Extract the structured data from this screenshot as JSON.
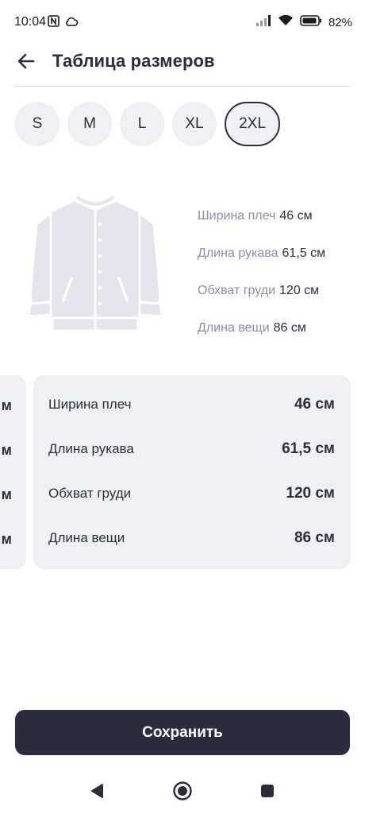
{
  "status_bar": {
    "time": "10:04",
    "battery": "82%",
    "icons": [
      "nfc-icon",
      "cloud-icon",
      "signal-icon",
      "wifi-icon",
      "battery-icon"
    ]
  },
  "header": {
    "title": "Таблица размеров",
    "back_icon": "arrow-left-icon"
  },
  "sizes": [
    {
      "label": "S",
      "selected": false
    },
    {
      "label": "M",
      "selected": false
    },
    {
      "label": "L",
      "selected": false
    },
    {
      "label": "XL",
      "selected": false
    },
    {
      "label": "2XL",
      "selected": true
    }
  ],
  "illustration": {
    "icon": "jacket-icon"
  },
  "measurements": [
    {
      "label": "Ширина плеч",
      "value": "46 см"
    },
    {
      "label": "Длина рукава",
      "value": "61,5 см"
    },
    {
      "label": "Обхват груди",
      "value": "120 см"
    },
    {
      "label": "Длина вещи",
      "value": "86 см"
    }
  ],
  "prev_card": {
    "values": [
      "м",
      "м",
      "м",
      "м"
    ]
  },
  "card": {
    "rows": [
      {
        "label": "Ширина плеч",
        "value": "46 см"
      },
      {
        "label": "Длина рукава",
        "value": "61,5 см"
      },
      {
        "label": "Обхват груди",
        "value": "120 см"
      },
      {
        "label": "Длина вещи",
        "value": "86 см"
      }
    ]
  },
  "save_label": "Сохранить",
  "nav": [
    "back-triangle-icon",
    "home-circle-icon",
    "recents-square-icon"
  ],
  "colors": {
    "primary": "#2b2d3f",
    "chip_bg": "#eff0f4",
    "muted_text": "#8b8da0"
  }
}
